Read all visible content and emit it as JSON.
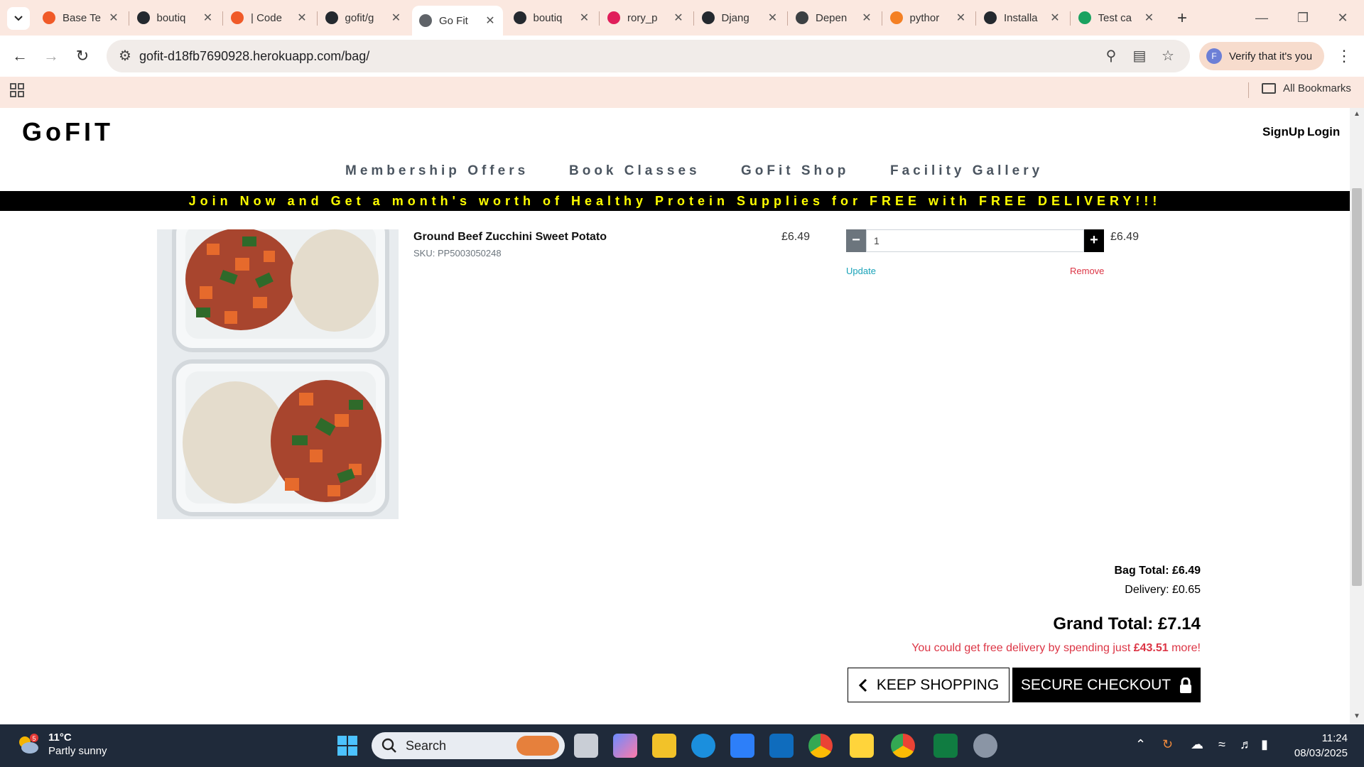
{
  "browser": {
    "tabs": [
      {
        "label": "Base Te",
        "color": "#f05a28"
      },
      {
        "label": "boutiq",
        "color": "#24292f"
      },
      {
        "label": "| Code",
        "color": "#f05a28"
      },
      {
        "label": "gofit/g",
        "color": "#24292f"
      },
      {
        "label": "Go Fit",
        "color": "#5f6368"
      },
      {
        "label": "boutiq",
        "color": "#24292f"
      },
      {
        "label": "rory_p",
        "color": "#e01e5a"
      },
      {
        "label": "Djang",
        "color": "#24292f"
      },
      {
        "label": "Depen",
        "color": "#3c4043"
      },
      {
        "label": "pythor",
        "color": "#f48024"
      },
      {
        "label": "Installa",
        "color": "#24292f"
      },
      {
        "label": "Test ca",
        "color": "#1aa260"
      }
    ],
    "url": "gofit-d18fb7690928.herokuapp.com/bag/",
    "verify_label": "Verify that it's you",
    "verify_avatar": "F",
    "all_bookmarks": "All Bookmarks"
  },
  "site": {
    "logo": "GoFIT",
    "signup": "SignUp",
    "login": "Login",
    "nav": [
      "Membership Offers",
      "Book Classes",
      "GoFit Shop",
      "Facility Gallery"
    ],
    "promo": "Join Now and Get a month's worth of Healthy Protein Supplies for FREE with FREE DELIVERY!!!"
  },
  "bag": {
    "item": {
      "name": "Ground Beef Zucchini Sweet Potato",
      "sku": "SKU: PP5003050248",
      "price": "£6.49",
      "quantity": "1",
      "subtotal": "£6.49",
      "update_label": "Update",
      "remove_label": "Remove"
    },
    "bag_total": "Bag Total: £6.49",
    "delivery": "Delivery: £0.65",
    "grand_total": "Grand Total: £7.14",
    "free_delivery_prefix": "You could get free delivery by spending just ",
    "free_delivery_amount": "£43.51",
    "free_delivery_suffix": " more!",
    "keep_shopping": "KEEP SHOPPING",
    "secure_checkout": "SECURE CHECKOUT"
  },
  "taskbar": {
    "weather_temp": "11°C",
    "weather_desc": "Partly sunny",
    "weather_badge": "5",
    "search_label": "Search",
    "time": "11:24",
    "date": "08/03/2025"
  },
  "colors": {
    "promo_bg": "#000000",
    "promo_text": "#ffff00",
    "update": "#17a2b8",
    "remove": "#dc3545",
    "minus_btn": "#6c757d",
    "plus_btn": "#000000"
  }
}
